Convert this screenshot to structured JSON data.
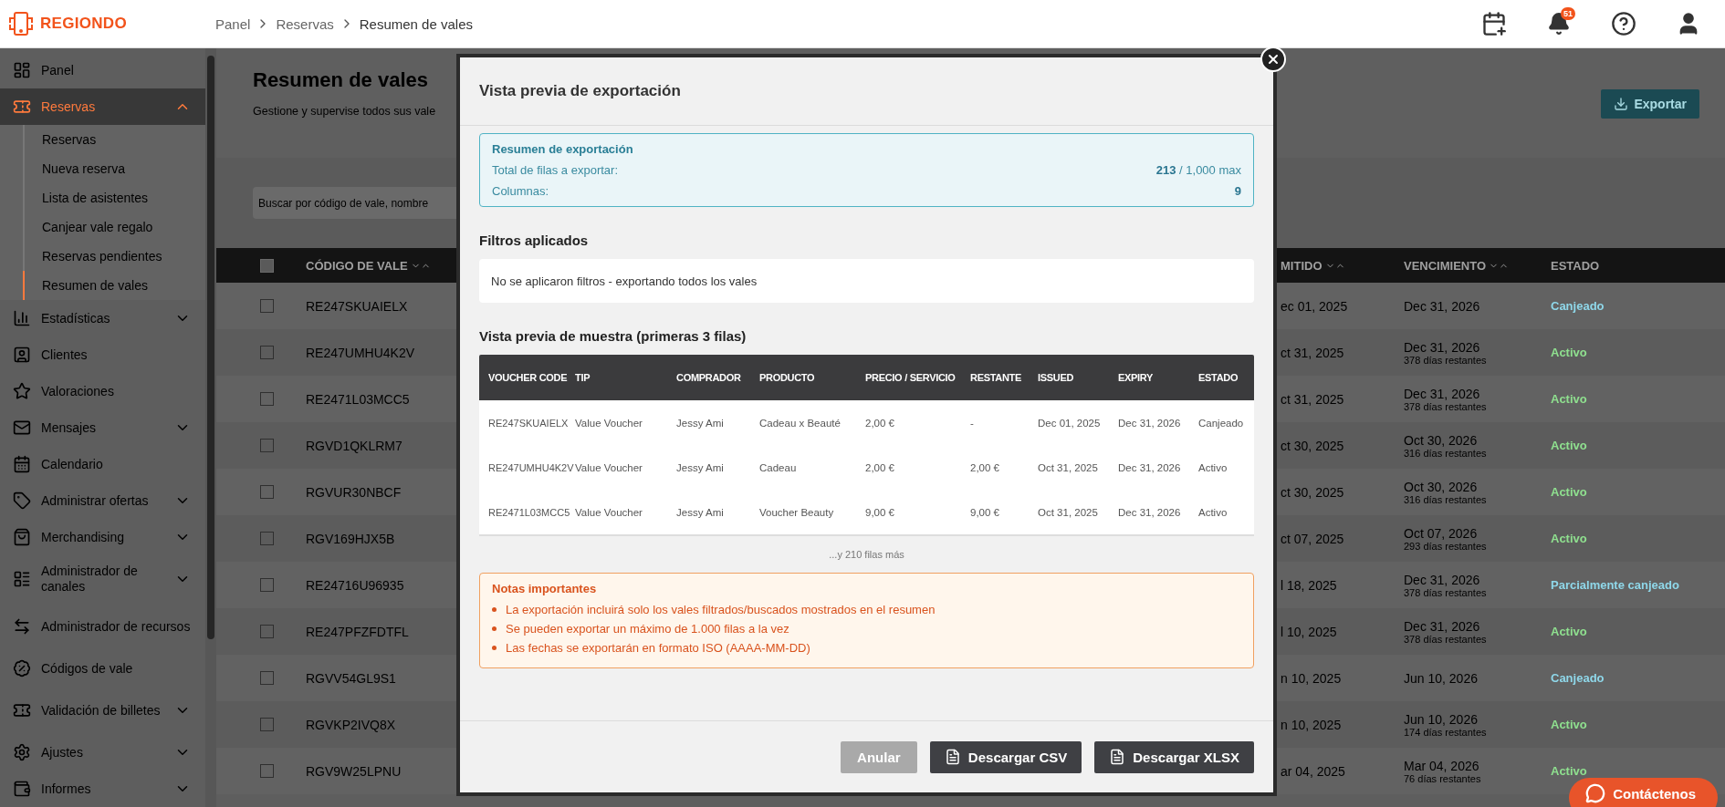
{
  "topbar": {
    "logo": "REGIONDO",
    "breadcrumb": [
      "Panel",
      "Reservas",
      "Resumen de vales"
    ],
    "notification_count": "51"
  },
  "sidebar": {
    "items": [
      {
        "kind": "link",
        "label": "Panel",
        "selected": false
      },
      {
        "kind": "group",
        "label": "Reservas",
        "selected": true,
        "expanded": true,
        "children": [
          {
            "label": "Reservas",
            "selected": false
          },
          {
            "label": "Nueva reserva",
            "selected": false
          },
          {
            "label": "Lista de asistentes",
            "selected": false
          },
          {
            "label": "Canjear vale regalo",
            "selected": false
          },
          {
            "label": "Reservas pendientes",
            "selected": false
          },
          {
            "label": "Resumen de vales",
            "selected": true
          }
        ]
      },
      {
        "kind": "group",
        "label": "Estadísticas",
        "selected": false,
        "expanded": false
      },
      {
        "kind": "link",
        "label": "Clientes",
        "selected": false
      },
      {
        "kind": "link",
        "label": "Valoraciones",
        "selected": false
      },
      {
        "kind": "group",
        "label": "Mensajes",
        "selected": false,
        "expanded": false
      },
      {
        "kind": "link",
        "label": "Calendario",
        "selected": false
      },
      {
        "kind": "group",
        "label": "Administrar ofertas",
        "selected": false,
        "expanded": false
      },
      {
        "kind": "group",
        "label": "Merchandising",
        "selected": false,
        "expanded": false
      },
      {
        "kind": "group",
        "label": "Administrador de canales",
        "selected": false,
        "expanded": false
      },
      {
        "kind": "link",
        "label": "Administrador de recursos",
        "selected": false
      },
      {
        "kind": "link",
        "label": "Códigos de vale",
        "selected": false
      },
      {
        "kind": "group",
        "label": "Validación de billetes",
        "selected": false,
        "expanded": false
      },
      {
        "kind": "group",
        "label": "Ajustes",
        "selected": false,
        "expanded": false
      },
      {
        "kind": "group",
        "label": "Informes",
        "selected": false,
        "expanded": false
      }
    ]
  },
  "page": {
    "title": "Resumen de vales",
    "subtitle": "Gestione y supervise todos sus vale",
    "export_button": "Exportar",
    "search": {
      "placeholder": "Buscar por código de vale, nombre"
    }
  },
  "vouchers_table": {
    "select_all": {
      "disabled": true
    },
    "columns": [
      {
        "label": "CÓDIGO DE VALE",
        "sortable": true
      },
      {
        "label": "MITIDO",
        "sortable": true
      },
      {
        "label": "VENCIMIENTO",
        "sortable": true
      },
      {
        "label": "ESTADO",
        "sortable": false
      }
    ],
    "rows": [
      {
        "checked": false,
        "code": "RE247SKUAIELX",
        "issued": "ec 01, 2025",
        "expiry": "Dec 31, 2026",
        "status": "Canjeado",
        "color": "#8fd8ea"
      },
      {
        "checked": false,
        "code": "RE247UMHU4K2V",
        "issued": "ct 31, 2025",
        "expiry": "Dec 31, 2026",
        "remaining": "378 días restantes",
        "status": "Activo",
        "color": "#8fe08f"
      },
      {
        "checked": false,
        "code": "RE2471L03MCC5",
        "issued": "ct 31, 2025",
        "expiry": "Dec 31, 2026",
        "remaining": "378 días restantes",
        "status": "Activo",
        "color": "#8fe08f"
      },
      {
        "checked": false,
        "code": "RGVD1QKLRM7",
        "issued": "ct 30, 2025",
        "expiry": "Oct 30, 2026",
        "remaining": "316 días restantes",
        "status": "Activo",
        "color": "#8fe08f"
      },
      {
        "checked": false,
        "code": "RGVUR30NBCF",
        "issued": "ct 30, 2025",
        "expiry": "Oct 30, 2026",
        "remaining": "316 días restantes",
        "status": "Activo",
        "color": "#8fe08f"
      },
      {
        "checked": false,
        "code": "RGV169HJX5B",
        "issued": "ct 07, 2025",
        "expiry": "Oct 07, 2026",
        "remaining": "293 días restantes",
        "status": "Activo",
        "color": "#8fe08f"
      },
      {
        "checked": false,
        "code": "RE24716U96935",
        "issued": "l 18, 2025",
        "expiry": "Dec 31, 2026",
        "remaining": "378 días restantes",
        "status": "Parcialmente canjeado",
        "color": "#8fd8ea"
      },
      {
        "checked": false,
        "code": "RE247PFZFDTFL",
        "issued": "l 10, 2025",
        "expiry": "Dec 31, 2026",
        "remaining": "378 días restantes",
        "status": "Activo",
        "color": "#8fe08f"
      },
      {
        "checked": false,
        "code": "RGVV54GL9S1",
        "issued": "n 10, 2025",
        "expiry": "Jun 10, 2026",
        "status": "Canjeado",
        "color": "#8fd8ea"
      },
      {
        "checked": false,
        "code": "RGVKP2IVQ8X",
        "issued": "n 10, 2025",
        "expiry": "Jun 10, 2026",
        "remaining": "174 días restantes",
        "status": "Activo",
        "color": "#8fe08f"
      },
      {
        "checked": false,
        "code": "RGV9W25LPNU",
        "issued": "ar 04, 2025",
        "expiry": "Mar 04, 2026",
        "remaining": "76 días restantes",
        "status": "Activo",
        "color": "#8fe08f"
      }
    ]
  },
  "modal": {
    "title": "Vista previa de exportación",
    "summary": {
      "title": "Resumen de exportación",
      "rows_label": "Total de filas a exportar:",
      "rows_count": "213",
      "rows_max": "/ 1,000 max",
      "columns_label": "Columnas:",
      "columns_count": "9"
    },
    "filters": {
      "title": "Filtros aplicados",
      "text": "No se aplicaron filtros - exportando todos los vales"
    },
    "preview": {
      "title": "Vista previa de muestra (primeras 3 filas)",
      "columns": [
        "VOUCHER CODE",
        "TIP",
        "COMPRADOR",
        "PRODUCTO",
        "PRECIO / SERVICIO",
        "RESTANTE",
        "ISSUED",
        "EXPIRY",
        "ESTADO"
      ],
      "rows": [
        [
          "RE247SKUAIELX",
          "Value Voucher",
          "Jessy Ami",
          "Cadeau x Beauté",
          "2,00 €",
          "-",
          "Dec 01, 2025",
          "Dec 31, 2026",
          "Canjeado"
        ],
        [
          "RE247UMHU4K2V",
          "Value Voucher",
          "Jessy Ami",
          "Cadeau",
          "2,00 €",
          "2,00 €",
          "Oct 31, 2025",
          "Dec 31, 2026",
          "Activo"
        ],
        [
          "RE2471L03MCC5",
          "Value Voucher",
          "Jessy Ami",
          "Voucher Beauty",
          "9,00 €",
          "9,00 €",
          "Oct 31, 2025",
          "Dec 31, 2026",
          "Activo"
        ]
      ],
      "more": "...y 210 filas más"
    },
    "notes": {
      "title": "Notas importantes",
      "items": [
        "La exportación incluirá solo los vales filtrados/buscados mostrados en el resumen",
        "Se pueden exportar un máximo de 1.000 filas a la vez",
        "Las fechas se exportarán en formato ISO (AAAA-MM-DD)"
      ]
    },
    "buttons": [
      {
        "kind": "cancel",
        "label": "Anular",
        "disabled": true
      },
      {
        "kind": "csv",
        "label": "Descargar CSV",
        "disabled": false
      },
      {
        "kind": "xlsx",
        "label": "Descargar XLSX",
        "disabled": false
      }
    ]
  },
  "contact_button": "Contáctenos"
}
